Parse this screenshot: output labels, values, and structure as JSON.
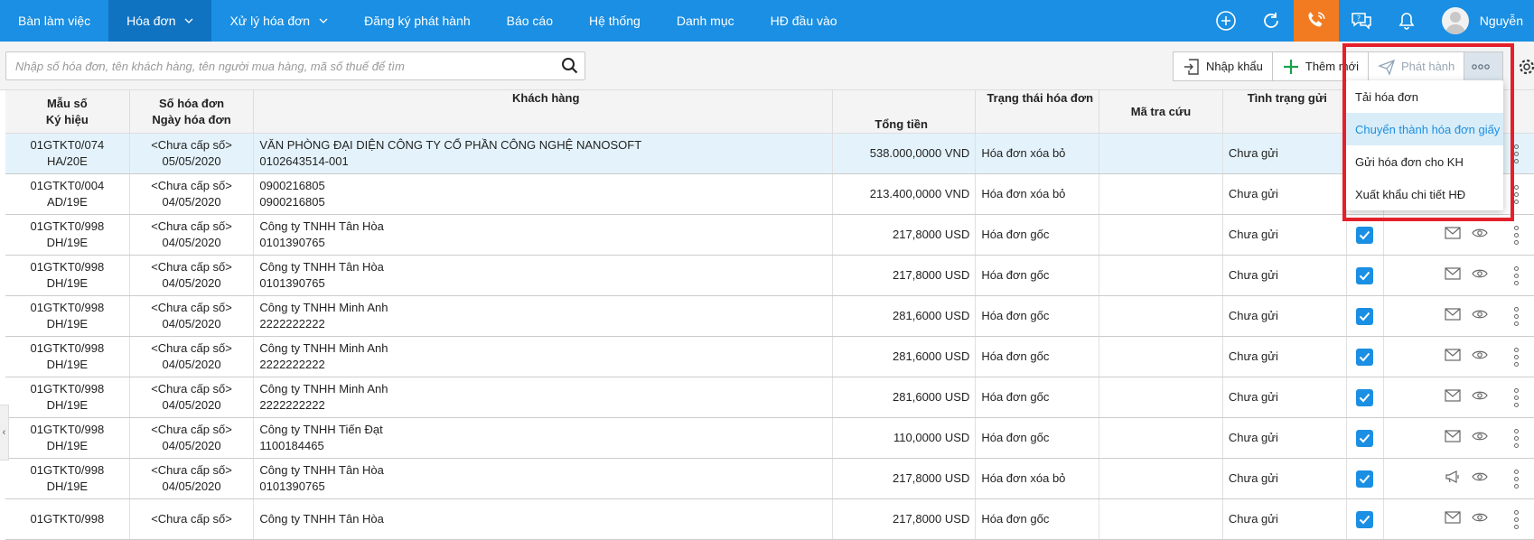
{
  "nav": {
    "items": [
      {
        "label": "Bàn làm việc",
        "active": false,
        "caret": false
      },
      {
        "label": "Hóa đơn",
        "active": true,
        "caret": true
      },
      {
        "label": "Xử lý hóa đơn",
        "active": false,
        "caret": true
      },
      {
        "label": "Đăng ký phát hành",
        "active": false,
        "caret": false
      },
      {
        "label": "Báo cáo",
        "active": false,
        "caret": false
      },
      {
        "label": "Hệ thống",
        "active": false,
        "caret": false
      },
      {
        "label": "Danh mục",
        "active": false,
        "caret": false
      },
      {
        "label": "HĐ đầu vào",
        "active": false,
        "caret": false
      }
    ],
    "user_name": "Nguyễn",
    "icons": [
      "plus-circle-icon",
      "refresh-icon",
      "phone-icon",
      "help-chat-icon",
      "bell-icon"
    ]
  },
  "toolbar": {
    "search_placeholder": "Nhập số hóa đơn, tên khách hàng, tên người mua hàng, mã số thuế để tìm",
    "import_label": "Nhập khẩu",
    "add_label": "Thêm mới",
    "publish_label": "Phát hành"
  },
  "table": {
    "headers": {
      "c1": "Mẫu số\nKý hiệu",
      "c2": "Số hóa đơn\nNgày hóa đơn",
      "c3": "Khách hàng",
      "c4": "Tổng tiền",
      "c5": "Trạng thái hóa đơn",
      "c6": "Mã tra cứu",
      "c7": "Tình trạng gửi"
    },
    "rows": [
      {
        "mau": "01GTKT0/074",
        "kh": "HA/20E",
        "so": "<Chưa cấp số>",
        "ngay": "05/05/2020",
        "cust": "VĂN PHÒNG ĐẠI DIỆN CÔNG TY CỔ PHẦN CÔNG NGHỆ NANOSOFT",
        "mst": "0102643514-001",
        "total": "538.000,0000 VND",
        "status": "Hóa đơn xóa bỏ",
        "send": "Chưa gửi",
        "hl": true,
        "actions": false,
        "send_icon": "mail-icon"
      },
      {
        "mau": "01GTKT0/004",
        "kh": "AD/19E",
        "so": "<Chưa cấp số>",
        "ngay": "04/05/2020",
        "cust": "0900216805",
        "mst": "0900216805",
        "total": "213.400,0000 VND",
        "status": "Hóa đơn xóa bỏ",
        "send": "Chưa gửi",
        "hl": false,
        "actions": false,
        "send_icon": "mail-icon"
      },
      {
        "mau": "01GTKT0/998",
        "kh": "DH/19E",
        "so": "<Chưa cấp số>",
        "ngay": "04/05/2020",
        "cust": "Công ty TNHH Tân Hòa",
        "mst": "0101390765",
        "total": "217,8000 USD",
        "status": "Hóa đơn gốc",
        "send": "Chưa gửi",
        "hl": false,
        "actions": true,
        "send_icon": "mail-icon"
      },
      {
        "mau": "01GTKT0/998",
        "kh": "DH/19E",
        "so": "<Chưa cấp số>",
        "ngay": "04/05/2020",
        "cust": "Công ty TNHH Tân Hòa",
        "mst": "0101390765",
        "total": "217,8000 USD",
        "status": "Hóa đơn gốc",
        "send": "Chưa gửi",
        "hl": false,
        "actions": true,
        "send_icon": "mail-icon"
      },
      {
        "mau": "01GTKT0/998",
        "kh": "DH/19E",
        "so": "<Chưa cấp số>",
        "ngay": "04/05/2020",
        "cust": "Công ty TNHH Minh Anh",
        "mst": "2222222222",
        "total": "281,6000 USD",
        "status": "Hóa đơn gốc",
        "send": "Chưa gửi",
        "hl": false,
        "actions": true,
        "send_icon": "mail-icon"
      },
      {
        "mau": "01GTKT0/998",
        "kh": "DH/19E",
        "so": "<Chưa cấp số>",
        "ngay": "04/05/2020",
        "cust": "Công ty TNHH Minh Anh",
        "mst": "2222222222",
        "total": "281,6000 USD",
        "status": "Hóa đơn gốc",
        "send": "Chưa gửi",
        "hl": false,
        "actions": true,
        "send_icon": "mail-icon"
      },
      {
        "mau": "01GTKT0/998",
        "kh": "DH/19E",
        "so": "<Chưa cấp số>",
        "ngay": "04/05/2020",
        "cust": "Công ty TNHH Minh Anh",
        "mst": "2222222222",
        "total": "281,6000 USD",
        "status": "Hóa đơn gốc",
        "send": "Chưa gửi",
        "hl": false,
        "actions": true,
        "send_icon": "mail-icon"
      },
      {
        "mau": "01GTKT0/998",
        "kh": "DH/19E",
        "so": "<Chưa cấp số>",
        "ngay": "04/05/2020",
        "cust": "Công ty TNHH Tiến Đạt",
        "mst": "1100184465",
        "total": "110,0000 USD",
        "status": "Hóa đơn gốc",
        "send": "Chưa gửi",
        "hl": false,
        "actions": true,
        "send_icon": "mail-icon"
      },
      {
        "mau": "01GTKT0/998",
        "kh": "DH/19E",
        "so": "<Chưa cấp số>",
        "ngay": "04/05/2020",
        "cust": "Công ty TNHH Tân Hòa",
        "mst": "0101390765",
        "total": "217,8000 USD",
        "status": "Hóa đơn xóa bỏ",
        "send": "Chưa gửi",
        "hl": false,
        "actions": true,
        "send_icon": "megaphone-icon"
      },
      {
        "mau": "01GTKT0/998",
        "kh": "",
        "so": "<Chưa cấp số>",
        "ngay": "",
        "cust": "Công ty TNHH Tân Hòa",
        "mst": "",
        "total": "217,8000 USD",
        "status": "Hóa đơn gốc",
        "send": "Chưa gửi",
        "hl": false,
        "actions": true,
        "send_icon": "mail-icon"
      }
    ]
  },
  "dropdown": {
    "items": [
      {
        "label": "Tải hóa đơn",
        "active": false
      },
      {
        "label": "Chuyển thành hóa đơn giấy",
        "active": true
      },
      {
        "label": "Gửi hóa đơn cho KH",
        "active": false
      },
      {
        "label": "Xuất khẩu chi tiết HĐ",
        "active": false
      }
    ]
  },
  "colors": {
    "nav_bg": "#1a8fe3",
    "nav_active": "#0f73c2",
    "phone_bg": "#f27b21",
    "highlight_border": "#e4202a",
    "row_highlight": "#e4f3fb"
  }
}
